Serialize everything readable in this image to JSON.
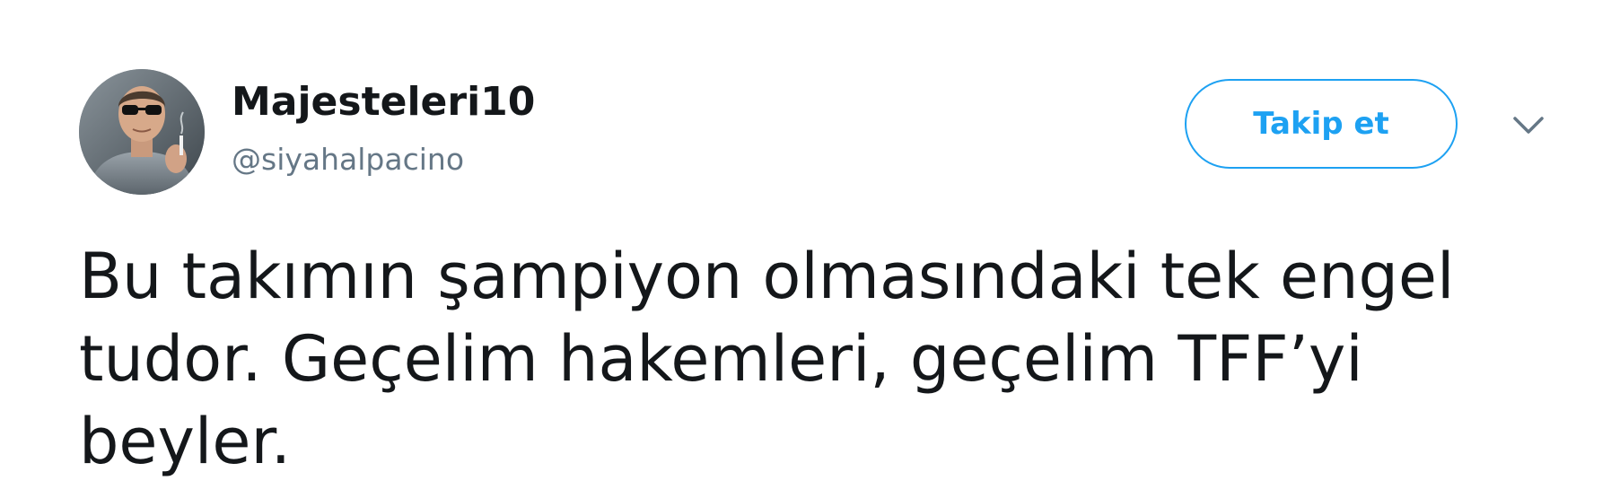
{
  "author": {
    "display_name": "Majesteleri10",
    "handle": "@siyahalpacino",
    "avatar_icon": "profile-photo"
  },
  "follow_button": {
    "label": "Takip et"
  },
  "menu": {
    "icon": "chevron-down-icon"
  },
  "tweet": {
    "text": "Bu takımın şampiyon olmasındaki tek engel\ntudor. Geçelim hakemleri, geçelim TFF’yi\nbeyler."
  },
  "colors": {
    "accent": "#1da1f2",
    "text": "#14171a",
    "secondary_text": "#657786"
  }
}
